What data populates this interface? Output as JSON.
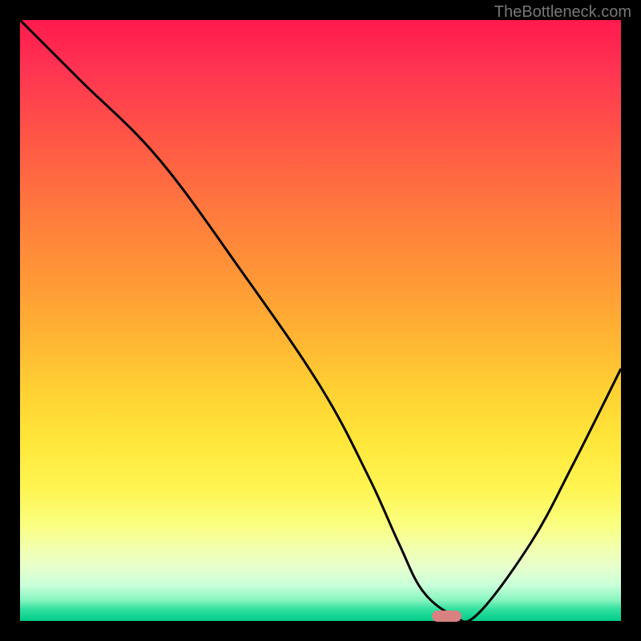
{
  "watermark": "TheBottleneck.com",
  "chart_data": {
    "type": "line",
    "title": "",
    "xlabel": "",
    "ylabel": "",
    "xlim": [
      0,
      100
    ],
    "ylim": [
      0,
      100
    ],
    "series": [
      {
        "name": "curve",
        "x": [
          0,
          10,
          23,
          37,
          50,
          58,
          63,
          67,
          72,
          76,
          85,
          92,
          100
        ],
        "values": [
          100,
          90,
          77,
          58,
          39,
          24,
          13,
          5,
          1,
          1,
          13,
          26,
          42
        ]
      }
    ],
    "marker": {
      "x_center": 71,
      "y": 0.5,
      "width_pct": 5
    },
    "gradient_stops": [
      {
        "pct": 0,
        "color": "#ff1a4d"
      },
      {
        "pct": 50,
        "color": "#ffb833"
      },
      {
        "pct": 80,
        "color": "#fff552"
      },
      {
        "pct": 100,
        "color": "#00cc88"
      }
    ]
  }
}
